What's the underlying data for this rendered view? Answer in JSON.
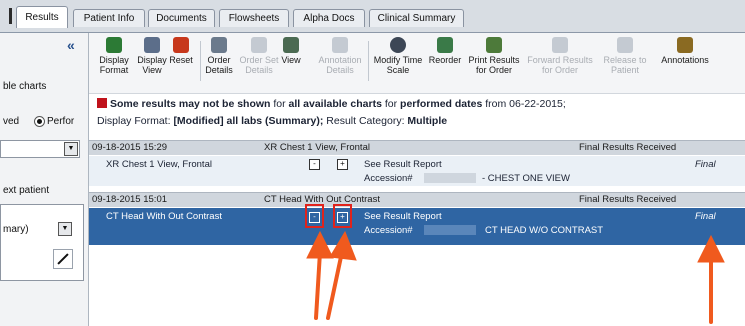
{
  "tabs": [
    "Results",
    "Patient Info",
    "Documents",
    "Flowsheets",
    "Alpha Docs",
    "Clinical Summary"
  ],
  "left_panel": {
    "collapse": "«",
    "charts_text": "ble charts",
    "radio_text": "ved",
    "radio_label": "Perfor",
    "next_patient": "ext patient",
    "dropdown_value": "mary)",
    "dropdown_arrow": "▼"
  },
  "toolbar": {
    "display_format": "Display Format",
    "display_view": "Display View",
    "reset_order": "Reset",
    "order_details": "Order Details",
    "order_set_details": "Order Set Details",
    "view": "View",
    "annotation_details": "Annotation Details",
    "modify_time_scale": "Modify Time Scale",
    "reorder": "Reorder",
    "print_results": "Print Results for Order",
    "forward_results": "Forward Results for Order",
    "release_to_patient": "Release to Patient",
    "annotations": "Annotations"
  },
  "notice": {
    "part1": "Some results may not be shown",
    "part2": " for ",
    "part3": "all available charts",
    "part4": " for ",
    "part5": "performed dates",
    "part6": " from 06-22-2015;"
  },
  "format_line": {
    "label": "Display Format: ",
    "value": "[Modified] all labs (Summary);",
    "cat_label": " Result Category: ",
    "cat_value": "Multiple"
  },
  "groups": [
    {
      "date": "09-18-2015 15:29",
      "title": "XR Chest 1 View, Frontal",
      "status": "Final Results Received",
      "item": "XR Chest 1 View, Frontal",
      "report": "See Result Report",
      "accession_label": "Accession#",
      "accession_desc": "- CHEST  ONE VIEW",
      "result_status": "Final"
    },
    {
      "date": "09-18-2015 15:01",
      "title": "CT Head With Out Contrast",
      "status": "Final Results Received",
      "item": "CT Head With Out Contrast",
      "report": "See Result Report",
      "accession_label": "Accession#",
      "accession_desc": "CT HEAD W/O CONTRAST",
      "result_status": "Final"
    }
  ],
  "colors": {
    "selected_row": "#2f65a3",
    "highlight": "#e0231c",
    "arrow": "#f05a1e",
    "warning": "#c0121b"
  }
}
